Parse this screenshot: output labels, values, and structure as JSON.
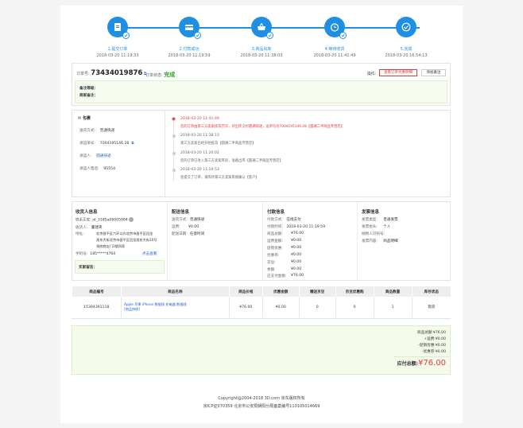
{
  "steps": [
    {
      "label": "1.提交订单",
      "time": "2018-03-20 11:19:33"
    },
    {
      "label": "2.付款成功",
      "time": "2018-03-20 11:19:59"
    },
    {
      "label": "3.商品出库",
      "time": "2018-03-20 11:38:03"
    },
    {
      "label": "4.等待收货",
      "time": "2018-03-20 11:41:49"
    },
    {
      "label": "5.完成",
      "time": "2018-03-20 16:54:13"
    }
  ],
  "order": {
    "number_label": "订单号:",
    "number": "73434019876",
    "status_label": "订单状态:",
    "status": "完成",
    "ops_label": "操作:",
    "btn_view": "查看订单优惠明细",
    "btn_note": "添加备注",
    "remark_level_label": "备注等级：",
    "merchant_remark_label": "商家备注："
  },
  "package": {
    "title": "包裹",
    "ship_method_label": "送货方式:",
    "ship_method": "普通快递",
    "tracking_label": "承运单号:",
    "tracking": "7004195146 28",
    "carrier_label": "承运人:",
    "carrier": "圆通快递",
    "carrier_phone_label": "承运人电话:",
    "carrier_phone": "95554"
  },
  "timeline": [
    {
      "time": "2018-03-20 11:41:49",
      "text": "您的订单由第三方卖家拣货完毕，待出库交付圆通快递，运单号为7004195146 28【圆通二手商品专营店】"
    },
    {
      "time": "2018-03-20 11:38:13",
      "text": "第三方卖家已经开始拣货【圆通二手商品专营店】"
    },
    {
      "time": "2018-03-20 11:20:01",
      "text": "您的订单已进入第三方卖家库房，准备出库【圆通二手商品专营店】"
    },
    {
      "time": "2018-03-20 11:19:53",
      "text": "您提交了订单，请等待第三方卖家系统确认【客户】"
    }
  ],
  "buyer": {
    "title": "收货人信息",
    "contact_label": "联系买家:",
    "contact": "jd_3185a06005994",
    "name_label": "收货人:",
    "name": "董建英",
    "address_label": "地址:",
    "address_l1": "北京昌平区六环以内北京市昌平区回龙",
    "address_l2": "观东大街北京市昌平区回龙观东大街10号",
    "address_l3": "领底商店门2楼四家",
    "phone_label": "手机号:",
    "phone": "185*****4764",
    "view_link": "点击查看",
    "buyer_msg_label": "买家留言："
  },
  "delivery": {
    "title": "配送信息",
    "method_label": "送货方式:",
    "method": "普通快递",
    "fee_label": "运费:",
    "fee": "¥0.00",
    "date_label": "配送日期:",
    "date": "任意时间"
  },
  "payment": {
    "title": "付款信息",
    "method_label": "付款方式:",
    "method": "在线支付",
    "time_label": "付款时间:",
    "time": "2018-03-20 11:19:59",
    "rows": [
      {
        "label": "商品总额:",
        "value": "¥76.00"
      },
      {
        "label": "运费金额:",
        "value": "¥0.00"
      },
      {
        "label": "促销优惠:",
        "value": "¥0.00"
      },
      {
        "label": "优惠券:",
        "value": "¥0.00"
      },
      {
        "label": "京豆:",
        "value": "¥0.00"
      },
      {
        "label": "余额:",
        "value": "¥0.00"
      },
      {
        "label": "应支付金额:",
        "value": "¥76.00"
      }
    ]
  },
  "invoice": {
    "title": "发票信息",
    "type_label": "发票类型:",
    "type": "普通发票",
    "header_label": "发票抬头:",
    "header": "个人",
    "taxid_label": "纳税人识别号:",
    "taxid": "",
    "content_label": "发票内容:",
    "content": "商品明细"
  },
  "goods_table": {
    "headers": [
      "商品编号",
      "商品名称",
      "商品价格",
      "优惠金额",
      "赠送京豆",
      "京豆优惠购",
      "商品数量",
      "库存状态"
    ],
    "row": {
      "id": "15394391118",
      "name": "Apple 苹果 iPhone 数据线 充电器 数据线",
      "tag": "[商品快照]",
      "price": "¥76.00",
      "discount": "¥0.00",
      "beans": "0",
      "bean_discount": "0",
      "qty": "1",
      "stock": "现货"
    }
  },
  "summary": {
    "goods_total": "商品总额:¥76.00",
    "shipping": "+运费:¥0.00",
    "promo": "-促销优惠:¥0.00",
    "coupon": "-优惠券:¥0.00",
    "payable_label": "应付总额:",
    "payable": "¥76.00"
  },
  "footer": {
    "line1": "Copyright@2004-2018 3D.com 京东版权所有",
    "line2": "京ICP证070359 北京市公安局朝阳分局备案编号110105014669"
  },
  "colors": {
    "accent": "#1f8fe4",
    "red": "#e4393c",
    "green": "#2aa52a"
  }
}
